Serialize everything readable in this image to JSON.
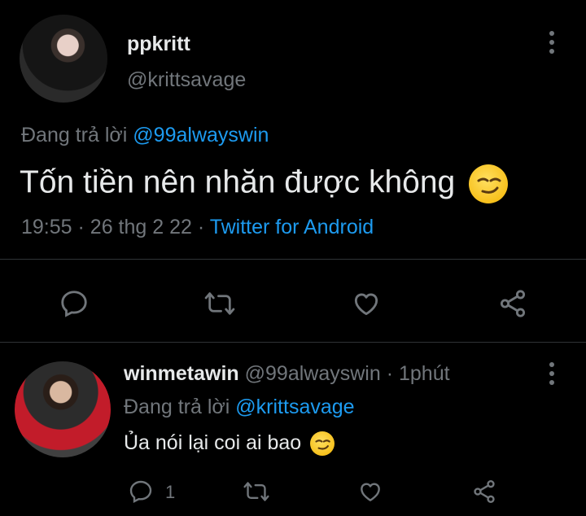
{
  "main_tweet": {
    "display_name": "ppkritt",
    "handle": "@krittsavage",
    "reply_prefix": "Đang trả lời",
    "reply_to": "@99alwayswin",
    "text": "Tốn tiền nên nhăn được không",
    "emoji": "smirk-emoji",
    "time": "19:55",
    "date": "26 thg 2 22",
    "source": "Twitter for Android"
  },
  "reply_tweet": {
    "display_name": "winmetawin",
    "handle": "@99alwayswin",
    "time_ago": "1phút",
    "reply_prefix": "Đang trả lời",
    "reply_to": "@krittsavage",
    "text": "Ủa nói lại coi ai bao",
    "emoji": "smirk-emoji",
    "reply_count": "1"
  },
  "colors": {
    "background": "#000000",
    "text": "#e7e9ea",
    "secondary": "#71767b",
    "link": "#1d9bf0",
    "divider": "#2f3336"
  },
  "icons": [
    "reply-icon",
    "retweet-icon",
    "like-icon",
    "share-icon",
    "more-icon"
  ]
}
